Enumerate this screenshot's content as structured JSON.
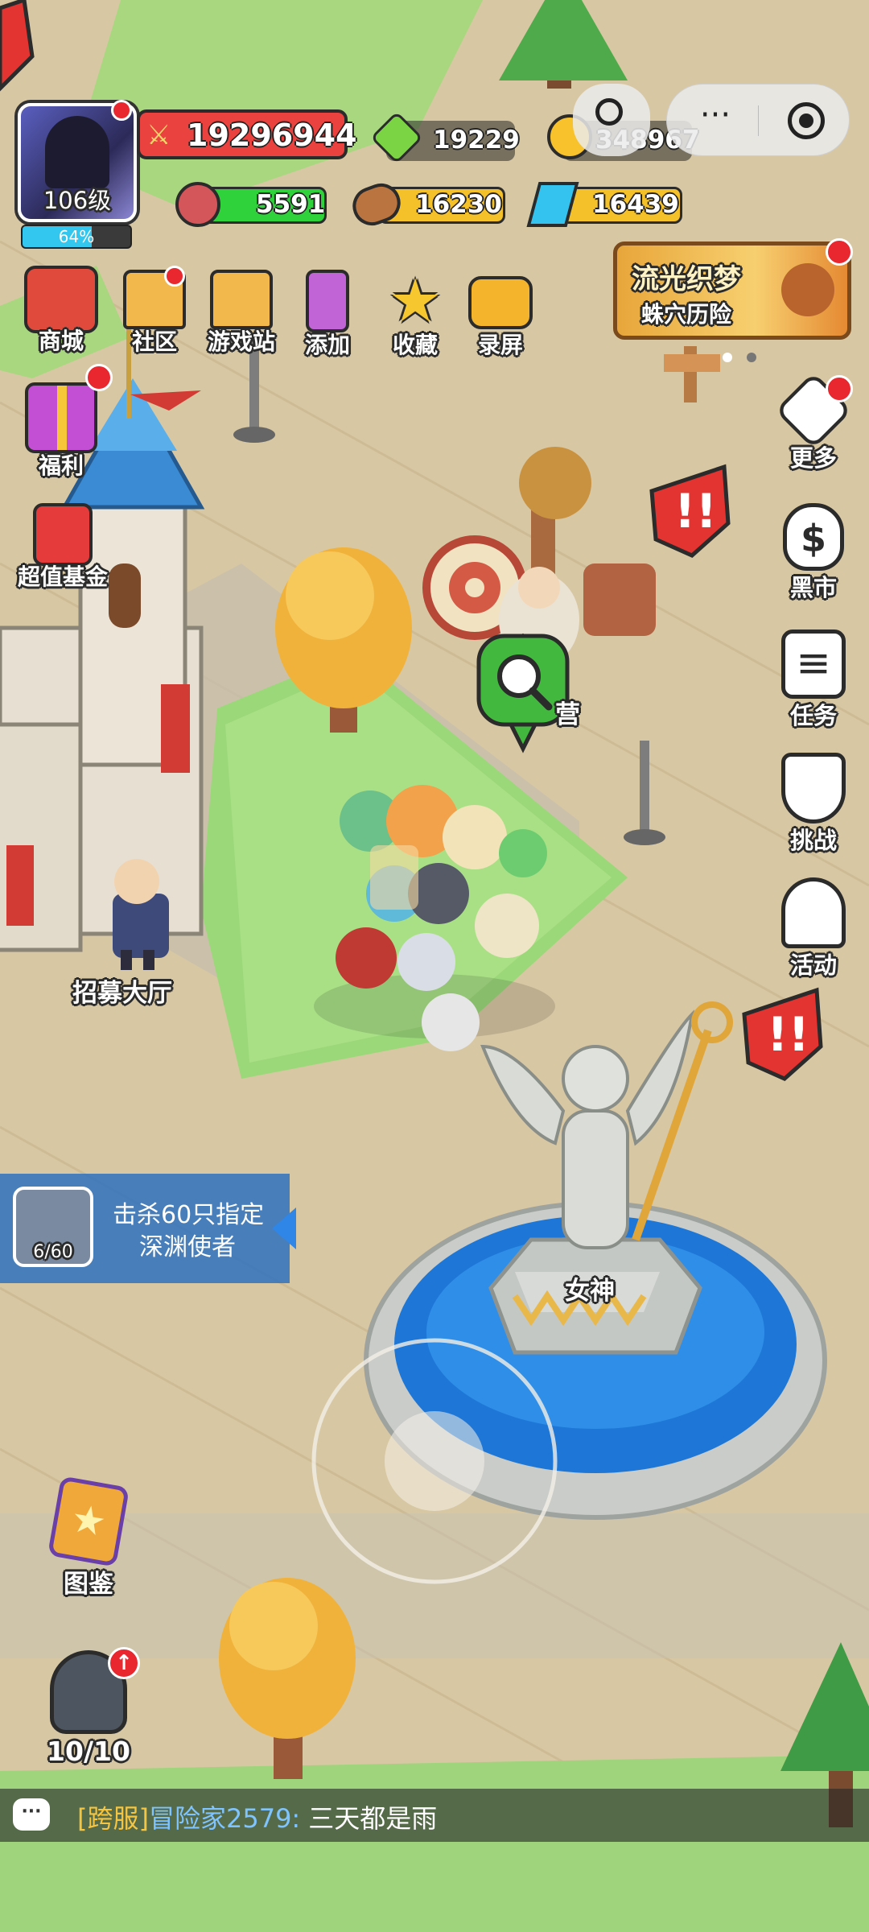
{
  "player": {
    "level_label": "106级",
    "exp_percent_label": "64%",
    "exp_fraction": 0.64
  },
  "resources": {
    "power": "19296944",
    "gems": "19229",
    "gold": "348967",
    "meat": "5591",
    "wood": "16230",
    "crystal": "16439"
  },
  "top_menu": [
    {
      "label": "商城",
      "icon": "shop-icon"
    },
    {
      "label": "社区",
      "icon": "community-house-icon"
    },
    {
      "label": "游戏站",
      "icon": "game-station-house-icon"
    },
    {
      "label": "添加",
      "icon": "phone-add-icon"
    },
    {
      "label": "收藏",
      "icon": "star-icon"
    },
    {
      "label": "录屏",
      "icon": "record-camera-icon"
    }
  ],
  "left_menu": [
    {
      "label": "福利",
      "icon": "gift-icon"
    },
    {
      "label": "超值基金",
      "icon": "fund-icon"
    }
  ],
  "event_banner": {
    "title": "流光织梦",
    "subtitle": "蛛穴历险"
  },
  "right_menu": [
    {
      "label": "更多",
      "icon": "dice-more-icon"
    },
    {
      "label": "黑市",
      "icon": "money-bag-icon"
    },
    {
      "label": "任务",
      "icon": "task-list-icon"
    },
    {
      "label": "挑战",
      "icon": "shield-icon"
    },
    {
      "label": "活动",
      "icon": "bell-icon"
    }
  ],
  "map_labels": {
    "recruit_hall": "招募大厅",
    "goddess": "女神",
    "partial_label": "营"
  },
  "quest": {
    "progress": "6/60",
    "text_line1": "击杀60只指定",
    "text_line2": "深渊使者"
  },
  "bottom_left": {
    "codex_label": "图鉴",
    "hero_count": "10/10"
  },
  "chat": {
    "channel": "[跨服]",
    "sender": "冒险家2579:",
    "message": "三天都是雨"
  },
  "colors": {
    "power_bar": "#e9423f",
    "gem_bar": "#8de13d",
    "meat_bar": "#2fd23a",
    "wood_bar": "#f4c12a",
    "crystal_bar": "#f4c12a",
    "exp_bar": "#33c6ee",
    "chat_channel": "#f5c542",
    "chat_sender": "#7fc4ff"
  }
}
